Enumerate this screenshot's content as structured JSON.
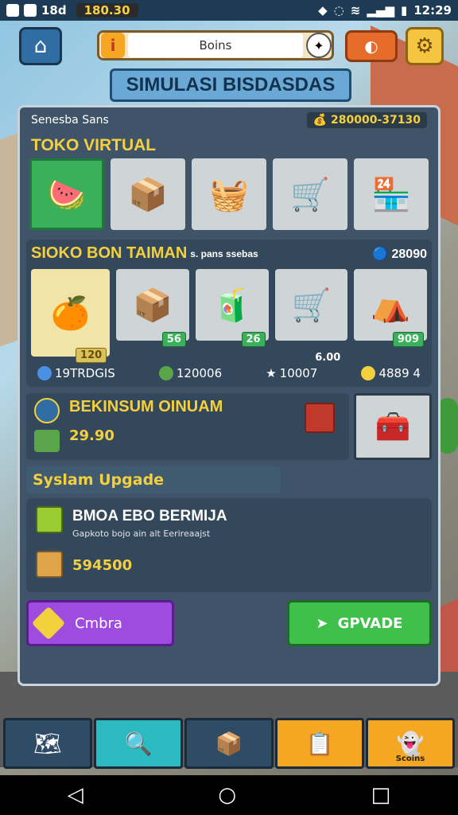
{
  "status_bar": {
    "left_icon_text": "18d",
    "pill_text": "180.30",
    "time": "12:29"
  },
  "top_bar": {
    "search_value": "Boins",
    "colors": {
      "home": "#2f6da3",
      "gear": "#f5c542",
      "sound": "#e56c2a"
    }
  },
  "title": "SIMULASI BISDASDAS",
  "panel": {
    "header_label": "Senesba Sans",
    "header_coins": "280000-37130",
    "shop_title": "TOKO VIRTUAL",
    "shop_items": [
      {
        "icon": "produce-crate-icon"
      },
      {
        "icon": "fabric-box-icon"
      },
      {
        "icon": "food-crate-icon"
      },
      {
        "icon": "shopping-cart-icon"
      },
      {
        "icon": "shop-counter-icon"
      }
    ],
    "store": {
      "title": "SIOKO BON TAIMAN",
      "subtitle": "s. pans ssebas",
      "count": "28090",
      "items": [
        {
          "icon": "fruit-tray-icon",
          "price": "120"
        },
        {
          "icon": "cardboard-box-icon",
          "price": "56"
        },
        {
          "icon": "display-shelf-icon",
          "price": "26"
        },
        {
          "icon": "cart-rack-icon",
          "price": "6.00"
        },
        {
          "icon": "market-stall-icon",
          "price": "909"
        }
      ],
      "stats": {
        "diamonds": "19TRDGIS",
        "gems": "120006",
        "stars": "10007",
        "coins": "4889 4"
      }
    },
    "promo": {
      "title": "BEKINSUM OINUAM",
      "value": "29.90"
    },
    "system_upgrade_label": "Syslam Upgade",
    "upgrade": {
      "title": "BMOA EBO BERMIJA",
      "description": "Gapkoto bojo ain alt Eerireaajst",
      "price": "594500"
    },
    "buttons": {
      "left": "Cmbra",
      "right": "GPVADE"
    }
  },
  "bottom_nav": {
    "items": [
      {
        "icon": "map-icon"
      },
      {
        "icon": "magnifier-icon"
      },
      {
        "icon": "box-icon"
      },
      {
        "icon": "clipboard-icon"
      },
      {
        "icon": "ghost-icon",
        "label": "Scoins"
      }
    ]
  }
}
